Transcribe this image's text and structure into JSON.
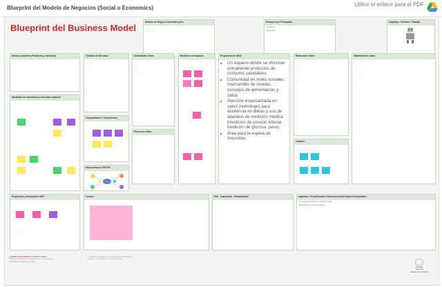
{
  "header": {
    "title": "Blueprint del Modelo de Negocios (Social o Economics)",
    "pdf_link": "Utilice el enlace para el PDF",
    "drive_icon": "google-drive-icon"
  },
  "board": {
    "main_title": "Blueprint del Business Model",
    "model_card": {
      "header": "Modelo de Negocio Diseñado para"
    },
    "strategy_card": {
      "header": "Enfoque y/o Principales",
      "fields": [
        "Cumplidos...",
        "Rasgos del..."
      ]
    },
    "logo_card": {
      "header": "Logotipo / Nombre / Trabajo"
    },
    "sections": {
      "users": "Datos y usuarios (Problema  y Solución)",
      "market": "Tamaño de Mercado",
      "activities": "Actividades Clave",
      "impact": "Medición de Impacto",
      "value": "Propuesta de Valor",
      "relations": "Relaciones Clave",
      "stakeholders": "Stakeholders Clave",
      "identity": "Identidad de innovación y del triple impacto",
      "competition": "Competidores / Competición",
      "macro": "Macroentorno PESTEL",
      "resources": "Recursos Clave",
      "channels": "Canales",
      "mvp": "Propuesta y declaración MVP",
      "costs": "Costos",
      "revenue": "ROI - Capacidad - Rentabilidad",
      "income": "Ingresos / Venta/Fondos Gubernamentales/Aportes/Operativo"
    },
    "value_proposition": [
      "Un espacio donde se ofrezcan únicamente productos de consumo saludables.",
      "Comunidad en redes sociales, intercambio de recetas, consejos de alimentación y salud",
      "Atención especializada en salud (nutriólogo) para asistencia en dietas y uso de aparatos de medición médica (medición de presión arterial, medición de glucosa, peso)",
      "Área para la espera de mascotas."
    ],
    "income_items": [
      "Venta de membresías de productos online",
      "Publicidad en la versión premium"
    ]
  },
  "footer": {
    "left_header": "¿QUIERE UN BLUEPRINT PLANTILLA AQUÍ?",
    "left_text": "El Blueprint del Modelo de Negocios es una herramienta diseñada para facilitar el proceso.",
    "mid_text": "Si usted necesita ayuda con el Blueprint del Modelo de Negocios, un consultor lo puede acompañar.",
    "brand": "GRANDE",
    "page": "página 41",
    "adapted": "Adaptado por el Equipo"
  },
  "colors": {
    "accent": "#d62828",
    "header_bg": "#dbe8d9"
  }
}
